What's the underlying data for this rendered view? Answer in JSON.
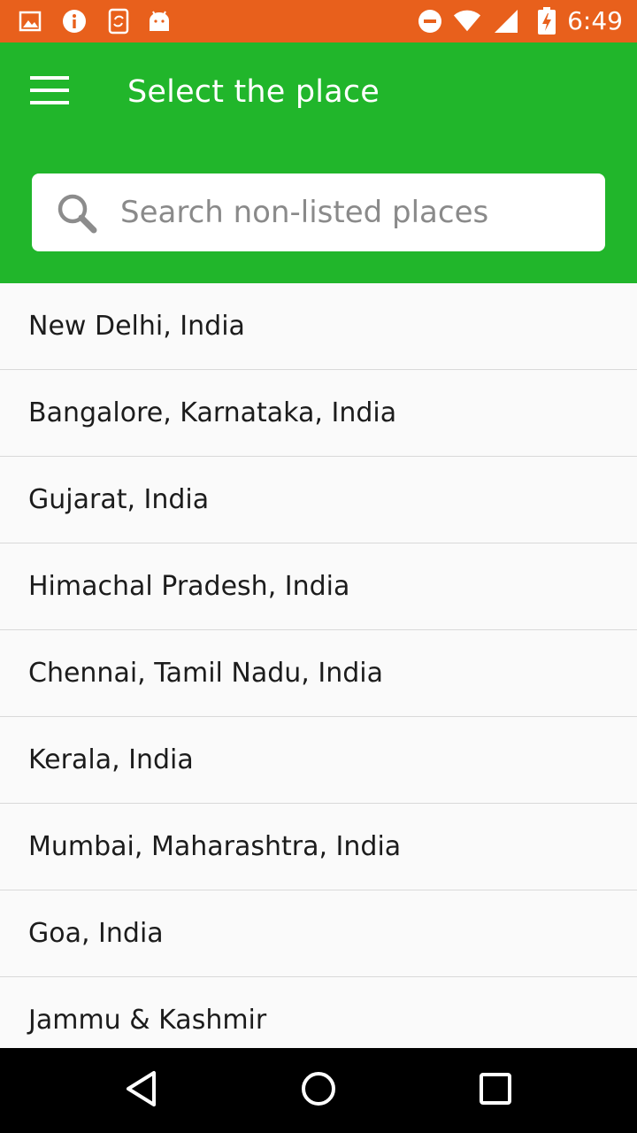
{
  "status_bar": {
    "time": "6:49",
    "left_icons": [
      "image-icon",
      "info-icon",
      "sync-phone-icon",
      "android-icon"
    ],
    "right_icons": [
      "do-not-disturb-icon",
      "wifi-icon",
      "cell-signal-icon",
      "battery-charging-icon"
    ]
  },
  "app_bar": {
    "title": "Select the place",
    "menu_icon": "hamburger-menu-icon"
  },
  "search": {
    "placeholder": "Search non-listed places",
    "value": ""
  },
  "places": [
    {
      "label": "New Delhi, India"
    },
    {
      "label": "Bangalore, Karnataka, India"
    },
    {
      "label": "Gujarat, India"
    },
    {
      "label": "Himachal Pradesh, India"
    },
    {
      "label": "Chennai, Tamil Nadu, India"
    },
    {
      "label": "Kerala, India"
    },
    {
      "label": "Mumbai, Maharashtra, India"
    },
    {
      "label": "Goa, India"
    },
    {
      "label": "Jammu & Kashmir"
    }
  ],
  "nav_bar": {
    "buttons": [
      "back-icon",
      "home-icon",
      "recents-icon"
    ]
  },
  "colors": {
    "status_bar": "#e8601c",
    "app_bar": "#21b62b",
    "list_bg": "#fafafa",
    "divider": "#d9d9d9"
  }
}
